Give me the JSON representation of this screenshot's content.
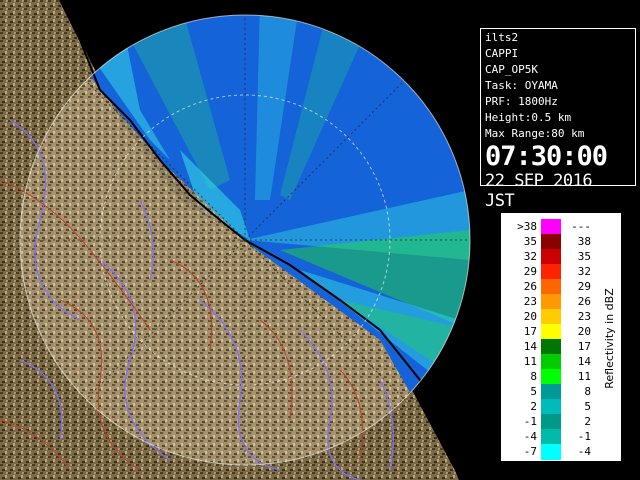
{
  "info": {
    "lines": [
      "ilts2",
      "CAPPI",
      "CAP_OP5K",
      "Task: OYAMA",
      "PRF: 1800Hz",
      "Height:0.5 km",
      "Max Range:80 km"
    ],
    "time": "07:30:00",
    "date": "22 SEP 2016 JST"
  },
  "legend": {
    "unit": "Reflectivity in dBZ",
    "rows": [
      {
        "lo": ">38",
        "hi": "---",
        "color": "#ff00ff"
      },
      {
        "lo": "35",
        "hi": "38",
        "color": "#8b0000"
      },
      {
        "lo": "32",
        "hi": "35",
        "color": "#cc0000"
      },
      {
        "lo": "29",
        "hi": "32",
        "color": "#ff2200"
      },
      {
        "lo": "26",
        "hi": "29",
        "color": "#ff6600"
      },
      {
        "lo": "23",
        "hi": "26",
        "color": "#ff9900"
      },
      {
        "lo": "20",
        "hi": "23",
        "color": "#ffcc00"
      },
      {
        "lo": "17",
        "hi": "20",
        "color": "#ffff00"
      },
      {
        "lo": "14",
        "hi": "17",
        "color": "#007700"
      },
      {
        "lo": "11",
        "hi": "14",
        "color": "#00cc00"
      },
      {
        "lo": "8",
        "hi": "11",
        "color": "#00ff00"
      },
      {
        "lo": "5",
        "hi": "8",
        "color": "#009999"
      },
      {
        "lo": "2",
        "hi": "5",
        "color": "#00bbbb"
      },
      {
        "lo": "-1",
        "hi": "2",
        "color": "#009988"
      },
      {
        "lo": "-4",
        "hi": "-1",
        "color": "#00bbaa"
      },
      {
        "lo": "-7",
        "hi": "-4",
        "color": "#00ffff"
      }
    ]
  },
  "colors": {
    "land": "#7a6a48",
    "sea": "#1463d8",
    "coastline": "#000000",
    "range_ring": "#ffffff",
    "river": "#7a70ff",
    "contour": "#b8402a"
  }
}
